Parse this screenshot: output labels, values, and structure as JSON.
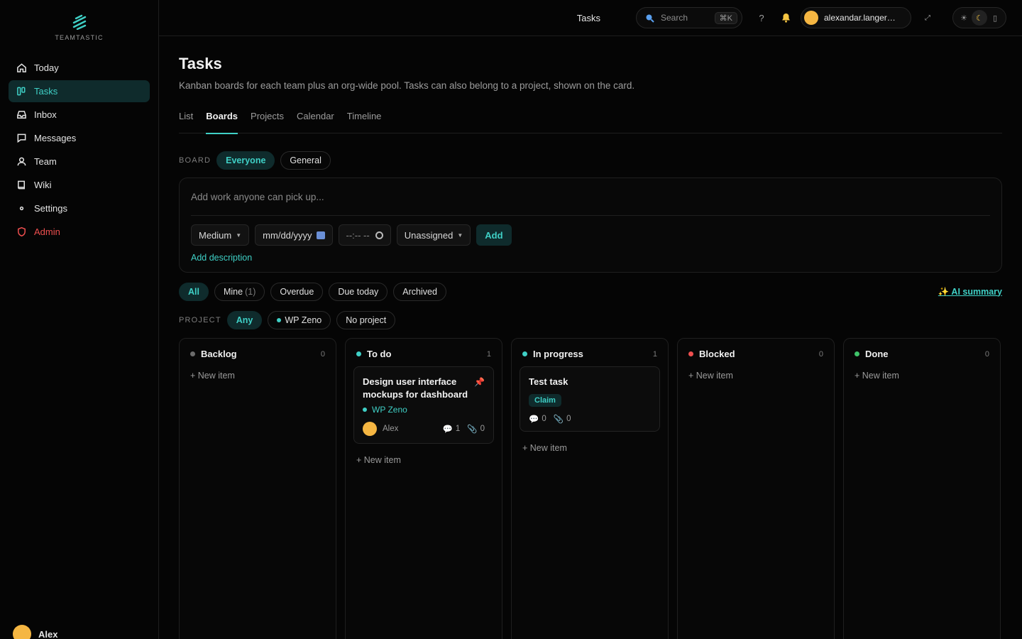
{
  "brand": {
    "name": "TEAMTASTIC"
  },
  "sidebar": {
    "items": [
      {
        "label": "Today",
        "icon": "home-icon"
      },
      {
        "label": "Tasks",
        "icon": "board-icon"
      },
      {
        "label": "Inbox",
        "icon": "inbox-icon"
      },
      {
        "label": "Messages",
        "icon": "message-icon"
      },
      {
        "label": "Team",
        "icon": "user-icon"
      },
      {
        "label": "Wiki",
        "icon": "book-icon"
      },
      {
        "label": "Settings",
        "icon": "dot-icon"
      },
      {
        "label": "Admin",
        "icon": "shield-icon"
      }
    ],
    "user": "Alex"
  },
  "topbar": {
    "title": "Tasks",
    "search_placeholder": "Search",
    "shortcut": "⌘K",
    "help": "?",
    "user_email": "alexandar.langer@g..."
  },
  "page": {
    "title": "Tasks",
    "subtitle": "Kanban boards for each team plus an org-wide pool. Tasks can also belong to a project, shown on the card."
  },
  "tabs": [
    "List",
    "Boards",
    "Projects",
    "Calendar",
    "Timeline"
  ],
  "board_filter": {
    "label": "BOARD",
    "options": [
      "Everyone",
      "General"
    ]
  },
  "composer": {
    "placeholder": "Add work anyone can pick up...",
    "priority": "Medium",
    "date_placeholder": "mm/dd/yyyy",
    "time_placeholder": "--:-- --",
    "assignee": "Unassigned",
    "add": "Add",
    "add_description": "Add description"
  },
  "filters": {
    "all": "All",
    "mine": "Mine",
    "mine_count": "(1)",
    "overdue": "Overdue",
    "due_today": "Due today",
    "archived": "Archived",
    "ai_summary": "✨ AI summary"
  },
  "project_filter": {
    "label": "PROJECT",
    "any": "Any",
    "wp_zeno": "WP Zeno",
    "none": "No project"
  },
  "columns": [
    {
      "name": "Backlog",
      "count": "0",
      "color": "#6b6b6b",
      "new_item": "+ New item"
    },
    {
      "name": "To do",
      "count": "1",
      "color": "#3fd0c6",
      "new_item": "+ New item"
    },
    {
      "name": "In progress",
      "count": "1",
      "color": "#3fd0c6",
      "new_item": "+ New item"
    },
    {
      "name": "Blocked",
      "count": "0",
      "color": "#ef4f4f",
      "new_item": "+ New item"
    },
    {
      "name": "Done",
      "count": "0",
      "color": "#3fc46a",
      "new_item": "+ New item"
    }
  ],
  "cards": {
    "todo": {
      "title": "Design user interface mockups for dashboard",
      "project": "WP Zeno",
      "assignee": "Alex",
      "comments": "1",
      "attachments": "0"
    },
    "in_progress": {
      "title": "Test task",
      "claim": "Claim",
      "comments": "0",
      "attachments": "0"
    }
  }
}
